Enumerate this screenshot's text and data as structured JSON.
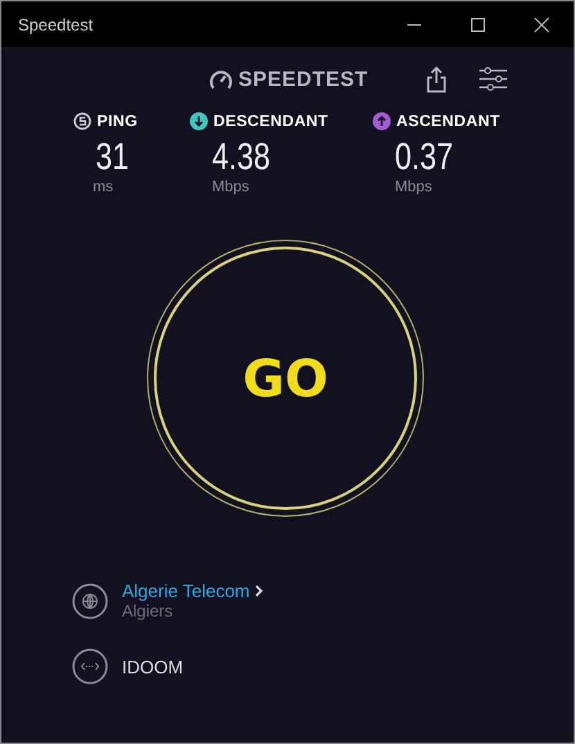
{
  "window": {
    "title": "Speedtest"
  },
  "header": {
    "logo": "SPEEDTEST"
  },
  "metrics": [
    {
      "kind": "ping",
      "label": "PING",
      "value": "31",
      "unit": "ms",
      "color": "#c9c9d1"
    },
    {
      "kind": "download",
      "label": "DESCENDANT",
      "value": "4.38",
      "unit": "Mbps",
      "color": "#3fc7c0"
    },
    {
      "kind": "upload",
      "label": "ASCENDANT",
      "value": "0.37",
      "unit": "Mbps",
      "color": "#a35bd6"
    }
  ],
  "go_button": {
    "label": "GO"
  },
  "provider": {
    "name": "Algerie Telecom",
    "location": "Algiers"
  },
  "server": {
    "name": "IDOOM"
  }
}
